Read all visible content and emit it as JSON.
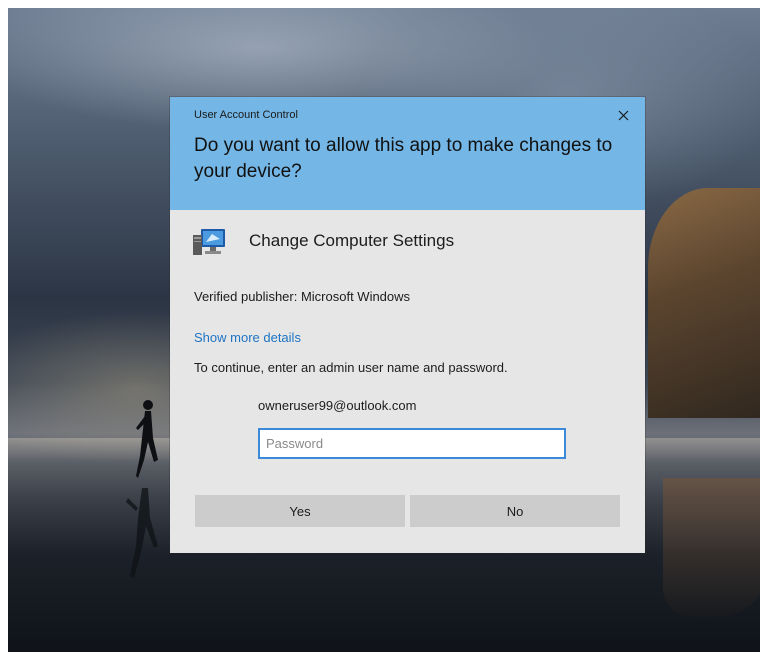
{
  "dialog": {
    "caption": "User Account Control",
    "headline": "Do you want to allow this app to make changes to your device?",
    "app_name": "Change Computer Settings",
    "app_icon": "computer-settings-icon",
    "publisher": "Verified publisher: Microsoft Windows",
    "details_link": "Show more details",
    "instruction": "To continue, enter an admin user name and password.",
    "username": "owneruser99@outlook.com",
    "password_placeholder": "Password",
    "password_value": "",
    "yes_label": "Yes",
    "no_label": "No",
    "close_icon": "close-icon"
  },
  "colors": {
    "header_blue": "#74b7e6",
    "body_gray": "#e6e6e6",
    "link_blue": "#1f74c4",
    "input_border": "#3b8ad8",
    "button_gray": "#cccccc"
  }
}
